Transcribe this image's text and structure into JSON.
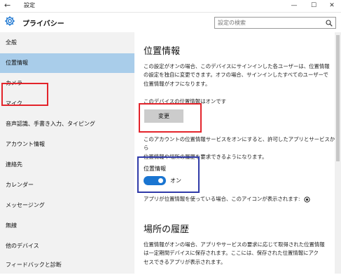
{
  "window": {
    "title": "設定",
    "back_glyph": "←",
    "minimize_glyph": "—",
    "maximize_glyph": "☐",
    "close_glyph": "✕"
  },
  "header": {
    "title": "プライバシー",
    "search_placeholder": "設定の検索"
  },
  "sidebar": {
    "selected_index": 1,
    "items": [
      {
        "label": "全般"
      },
      {
        "label": "位置情報"
      },
      {
        "label": "カメラ"
      },
      {
        "label": "マイク"
      },
      {
        "label": "音声認識、手書き入力、タイピング"
      },
      {
        "label": "アカウント情報"
      },
      {
        "label": "連絡先"
      },
      {
        "label": "カレンダー"
      },
      {
        "label": "メッセージング"
      },
      {
        "label": "無線"
      },
      {
        "label": "他のデバイス"
      },
      {
        "label": "フィードバックと診断"
      }
    ]
  },
  "main": {
    "section_title": "位置情報",
    "intro_lines": [
      "この設定がオンの場合、このデバイスにサインインした各ユーザーは、位置情報",
      "の設定を独自に変更できます。オフの場合、サインインしたすべてのユーザーで",
      "位置情報がオフになります。"
    ],
    "device_status": "このデバイスの位置情報はオンです",
    "change_button": "変更",
    "service_lines": [
      "このアカウントの位置情報サービスをオンにすると、許可したアプリとサービスから",
      "位置情報や場所の履歴を要求できるようになります。"
    ],
    "toggle_label": "位置情報",
    "toggle_state": "オン",
    "toggle_on": true,
    "icon_note": "アプリが位置情報を使っている場合、このアイコンが表示されます:",
    "history_title": "場所の履歴",
    "history_lines": [
      "位置情報がオンの場合、アプリやサービスの要求に応じて取得された位置情報",
      "は一定期間デバイスに保存されます。ここには、保存された位置情報にアク",
      "セスできるアプリが表示されます。"
    ]
  },
  "colors": {
    "selected_bg": "#a9cdea",
    "toggle_on": "#1a75d1",
    "highlight_red": "#e3242b",
    "highlight_blue": "#2f3aa8"
  }
}
